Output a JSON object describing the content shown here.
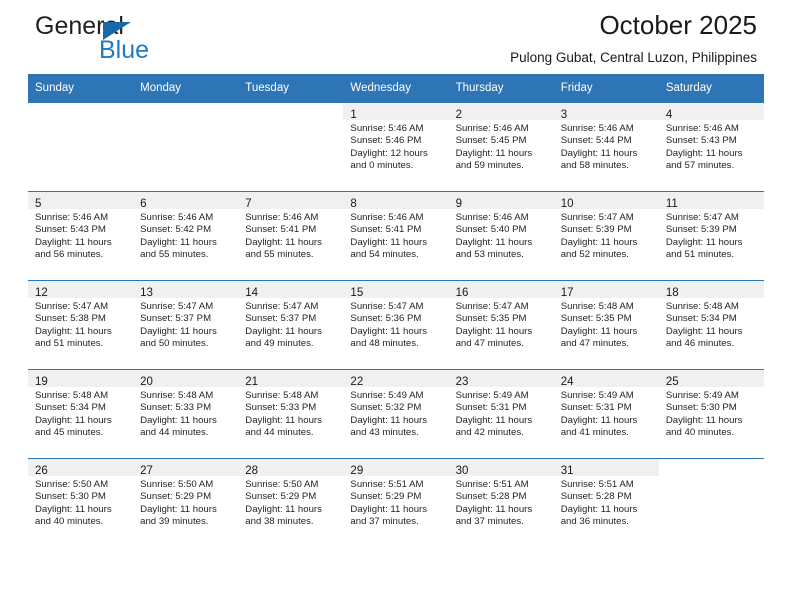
{
  "brand": {
    "word_top": "General",
    "word_bottom": "Blue",
    "triangle_color": "#1769aa",
    "blue_color": "#1f7ac0"
  },
  "header": {
    "title": "October 2025",
    "subtitle": "Pulong Gubat, Central Luzon, Philippines"
  },
  "theme": {
    "header_blue": "#2e75b6",
    "daynum_band": "#f0f0f0",
    "text": "#231f20"
  },
  "weekdays": [
    "Sunday",
    "Monday",
    "Tuesday",
    "Wednesday",
    "Thursday",
    "Friday",
    "Saturday"
  ],
  "labels": {
    "sunrise_prefix": "Sunrise:",
    "sunset_prefix": "Sunset:",
    "daylight_prefix": "Daylight:"
  },
  "weeks": [
    [
      {
        "day": "",
        "blank": true
      },
      {
        "day": "",
        "blank": true
      },
      {
        "day": "",
        "blank": true
      },
      {
        "day": "1",
        "sunrise": "Sunrise: 5:46 AM",
        "sunset": "Sunset: 5:46 PM",
        "daylight_line1": "Daylight: 12 hours",
        "daylight_line2": "and 0 minutes."
      },
      {
        "day": "2",
        "sunrise": "Sunrise: 5:46 AM",
        "sunset": "Sunset: 5:45 PM",
        "daylight_line1": "Daylight: 11 hours",
        "daylight_line2": "and 59 minutes."
      },
      {
        "day": "3",
        "sunrise": "Sunrise: 5:46 AM",
        "sunset": "Sunset: 5:44 PM",
        "daylight_line1": "Daylight: 11 hours",
        "daylight_line2": "and 58 minutes."
      },
      {
        "day": "4",
        "sunrise": "Sunrise: 5:46 AM",
        "sunset": "Sunset: 5:43 PM",
        "daylight_line1": "Daylight: 11 hours",
        "daylight_line2": "and 57 minutes."
      }
    ],
    [
      {
        "day": "5",
        "sunrise": "Sunrise: 5:46 AM",
        "sunset": "Sunset: 5:43 PM",
        "daylight_line1": "Daylight: 11 hours",
        "daylight_line2": "and 56 minutes."
      },
      {
        "day": "6",
        "sunrise": "Sunrise: 5:46 AM",
        "sunset": "Sunset: 5:42 PM",
        "daylight_line1": "Daylight: 11 hours",
        "daylight_line2": "and 55 minutes."
      },
      {
        "day": "7",
        "sunrise": "Sunrise: 5:46 AM",
        "sunset": "Sunset: 5:41 PM",
        "daylight_line1": "Daylight: 11 hours",
        "daylight_line2": "and 55 minutes."
      },
      {
        "day": "8",
        "sunrise": "Sunrise: 5:46 AM",
        "sunset": "Sunset: 5:41 PM",
        "daylight_line1": "Daylight: 11 hours",
        "daylight_line2": "and 54 minutes."
      },
      {
        "day": "9",
        "sunrise": "Sunrise: 5:46 AM",
        "sunset": "Sunset: 5:40 PM",
        "daylight_line1": "Daylight: 11 hours",
        "daylight_line2": "and 53 minutes."
      },
      {
        "day": "10",
        "sunrise": "Sunrise: 5:47 AM",
        "sunset": "Sunset: 5:39 PM",
        "daylight_line1": "Daylight: 11 hours",
        "daylight_line2": "and 52 minutes."
      },
      {
        "day": "11",
        "sunrise": "Sunrise: 5:47 AM",
        "sunset": "Sunset: 5:39 PM",
        "daylight_line1": "Daylight: 11 hours",
        "daylight_line2": "and 51 minutes."
      }
    ],
    [
      {
        "day": "12",
        "sunrise": "Sunrise: 5:47 AM",
        "sunset": "Sunset: 5:38 PM",
        "daylight_line1": "Daylight: 11 hours",
        "daylight_line2": "and 51 minutes."
      },
      {
        "day": "13",
        "sunrise": "Sunrise: 5:47 AM",
        "sunset": "Sunset: 5:37 PM",
        "daylight_line1": "Daylight: 11 hours",
        "daylight_line2": "and 50 minutes."
      },
      {
        "day": "14",
        "sunrise": "Sunrise: 5:47 AM",
        "sunset": "Sunset: 5:37 PM",
        "daylight_line1": "Daylight: 11 hours",
        "daylight_line2": "and 49 minutes."
      },
      {
        "day": "15",
        "sunrise": "Sunrise: 5:47 AM",
        "sunset": "Sunset: 5:36 PM",
        "daylight_line1": "Daylight: 11 hours",
        "daylight_line2": "and 48 minutes."
      },
      {
        "day": "16",
        "sunrise": "Sunrise: 5:47 AM",
        "sunset": "Sunset: 5:35 PM",
        "daylight_line1": "Daylight: 11 hours",
        "daylight_line2": "and 47 minutes."
      },
      {
        "day": "17",
        "sunrise": "Sunrise: 5:48 AM",
        "sunset": "Sunset: 5:35 PM",
        "daylight_line1": "Daylight: 11 hours",
        "daylight_line2": "and 47 minutes."
      },
      {
        "day": "18",
        "sunrise": "Sunrise: 5:48 AM",
        "sunset": "Sunset: 5:34 PM",
        "daylight_line1": "Daylight: 11 hours",
        "daylight_line2": "and 46 minutes."
      }
    ],
    [
      {
        "day": "19",
        "sunrise": "Sunrise: 5:48 AM",
        "sunset": "Sunset: 5:34 PM",
        "daylight_line1": "Daylight: 11 hours",
        "daylight_line2": "and 45 minutes."
      },
      {
        "day": "20",
        "sunrise": "Sunrise: 5:48 AM",
        "sunset": "Sunset: 5:33 PM",
        "daylight_line1": "Daylight: 11 hours",
        "daylight_line2": "and 44 minutes."
      },
      {
        "day": "21",
        "sunrise": "Sunrise: 5:48 AM",
        "sunset": "Sunset: 5:33 PM",
        "daylight_line1": "Daylight: 11 hours",
        "daylight_line2": "and 44 minutes."
      },
      {
        "day": "22",
        "sunrise": "Sunrise: 5:49 AM",
        "sunset": "Sunset: 5:32 PM",
        "daylight_line1": "Daylight: 11 hours",
        "daylight_line2": "and 43 minutes."
      },
      {
        "day": "23",
        "sunrise": "Sunrise: 5:49 AM",
        "sunset": "Sunset: 5:31 PM",
        "daylight_line1": "Daylight: 11 hours",
        "daylight_line2": "and 42 minutes."
      },
      {
        "day": "24",
        "sunrise": "Sunrise: 5:49 AM",
        "sunset": "Sunset: 5:31 PM",
        "daylight_line1": "Daylight: 11 hours",
        "daylight_line2": "and 41 minutes."
      },
      {
        "day": "25",
        "sunrise": "Sunrise: 5:49 AM",
        "sunset": "Sunset: 5:30 PM",
        "daylight_line1": "Daylight: 11 hours",
        "daylight_line2": "and 40 minutes."
      }
    ],
    [
      {
        "day": "26",
        "sunrise": "Sunrise: 5:50 AM",
        "sunset": "Sunset: 5:30 PM",
        "daylight_line1": "Daylight: 11 hours",
        "daylight_line2": "and 40 minutes."
      },
      {
        "day": "27",
        "sunrise": "Sunrise: 5:50 AM",
        "sunset": "Sunset: 5:29 PM",
        "daylight_line1": "Daylight: 11 hours",
        "daylight_line2": "and 39 minutes."
      },
      {
        "day": "28",
        "sunrise": "Sunrise: 5:50 AM",
        "sunset": "Sunset: 5:29 PM",
        "daylight_line1": "Daylight: 11 hours",
        "daylight_line2": "and 38 minutes."
      },
      {
        "day": "29",
        "sunrise": "Sunrise: 5:51 AM",
        "sunset": "Sunset: 5:29 PM",
        "daylight_line1": "Daylight: 11 hours",
        "daylight_line2": "and 37 minutes."
      },
      {
        "day": "30",
        "sunrise": "Sunrise: 5:51 AM",
        "sunset": "Sunset: 5:28 PM",
        "daylight_line1": "Daylight: 11 hours",
        "daylight_line2": "and 37 minutes."
      },
      {
        "day": "31",
        "sunrise": "Sunrise: 5:51 AM",
        "sunset": "Sunset: 5:28 PM",
        "daylight_line1": "Daylight: 11 hours",
        "daylight_line2": "and 36 minutes."
      },
      {
        "day": "",
        "blank": true
      }
    ]
  ]
}
